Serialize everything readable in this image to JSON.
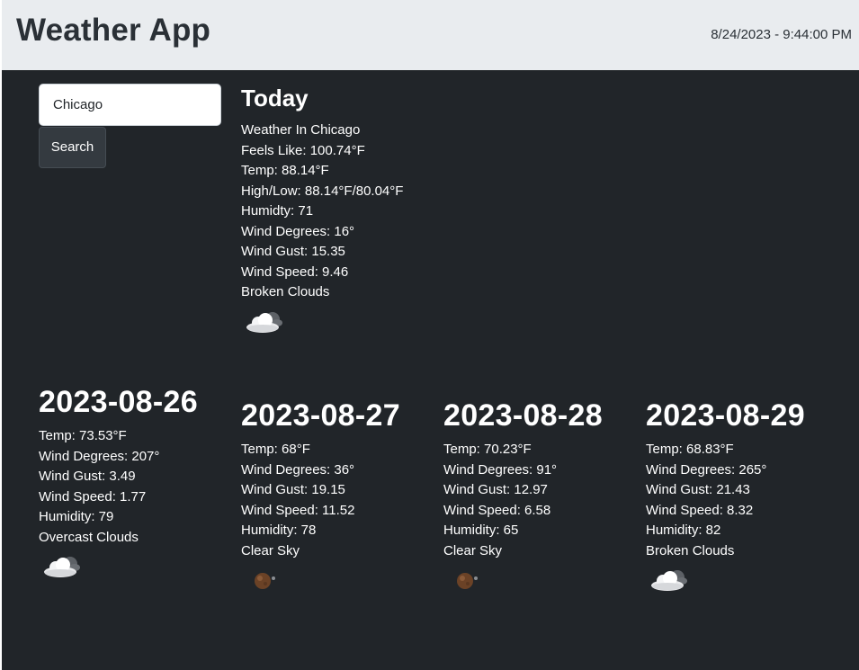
{
  "header": {
    "title": "Weather App",
    "datetime": "8/24/2023 - 9:44:00 PM"
  },
  "search": {
    "value": "Chicago",
    "button_label": "Search"
  },
  "today": {
    "title": "Today",
    "location": "Weather In Chicago",
    "feels_like": "Feels Like: 100.74°F",
    "temp": "Temp: 88.14°F",
    "high_low": "High/Low: 88.14°F/80.04°F",
    "humidity": "Humidty: 71",
    "wind_degrees": "Wind Degrees: 16°",
    "wind_gust": "Wind Gust: 15.35",
    "wind_speed": "Wind Speed: 9.46",
    "description": "Broken Clouds",
    "icon": "cloud-icon"
  },
  "forecast": [
    {
      "date": "2023-08-26",
      "temp": "Temp: 73.53°F",
      "wind_degrees": "Wind Degrees: 207°",
      "wind_gust": "Wind Gust: 3.49",
      "wind_speed": "Wind Speed: 1.77",
      "humidity": "Humidity: 79",
      "description": "Overcast Clouds",
      "icon": "cloud-icon"
    },
    {
      "date": "2023-08-27",
      "temp": "Temp: 68°F",
      "wind_degrees": "Wind Degrees: 36°",
      "wind_gust": "Wind Gust: 19.15",
      "wind_speed": "Wind Speed: 11.52",
      "humidity": "Humidity: 78",
      "description": "Clear Sky",
      "icon": "moon-icon"
    },
    {
      "date": "2023-08-28",
      "temp": "Temp: 70.23°F",
      "wind_degrees": "Wind Degrees: 91°",
      "wind_gust": "Wind Gust: 12.97",
      "wind_speed": "Wind Speed: 6.58",
      "humidity": "Humidity: 65",
      "description": "Clear Sky",
      "icon": "moon-icon"
    },
    {
      "date": "2023-08-29",
      "temp": "Temp: 68.83°F",
      "wind_degrees": "Wind Degrees: 265°",
      "wind_gust": "Wind Gust: 21.43",
      "wind_speed": "Wind Speed: 8.32",
      "humidity": "Humidity: 82",
      "description": "Broken Clouds",
      "icon": "cloud-icon"
    }
  ],
  "colors": {
    "header_bg": "#e9ecef",
    "main_bg": "#212529",
    "button_bg": "#343a40"
  }
}
